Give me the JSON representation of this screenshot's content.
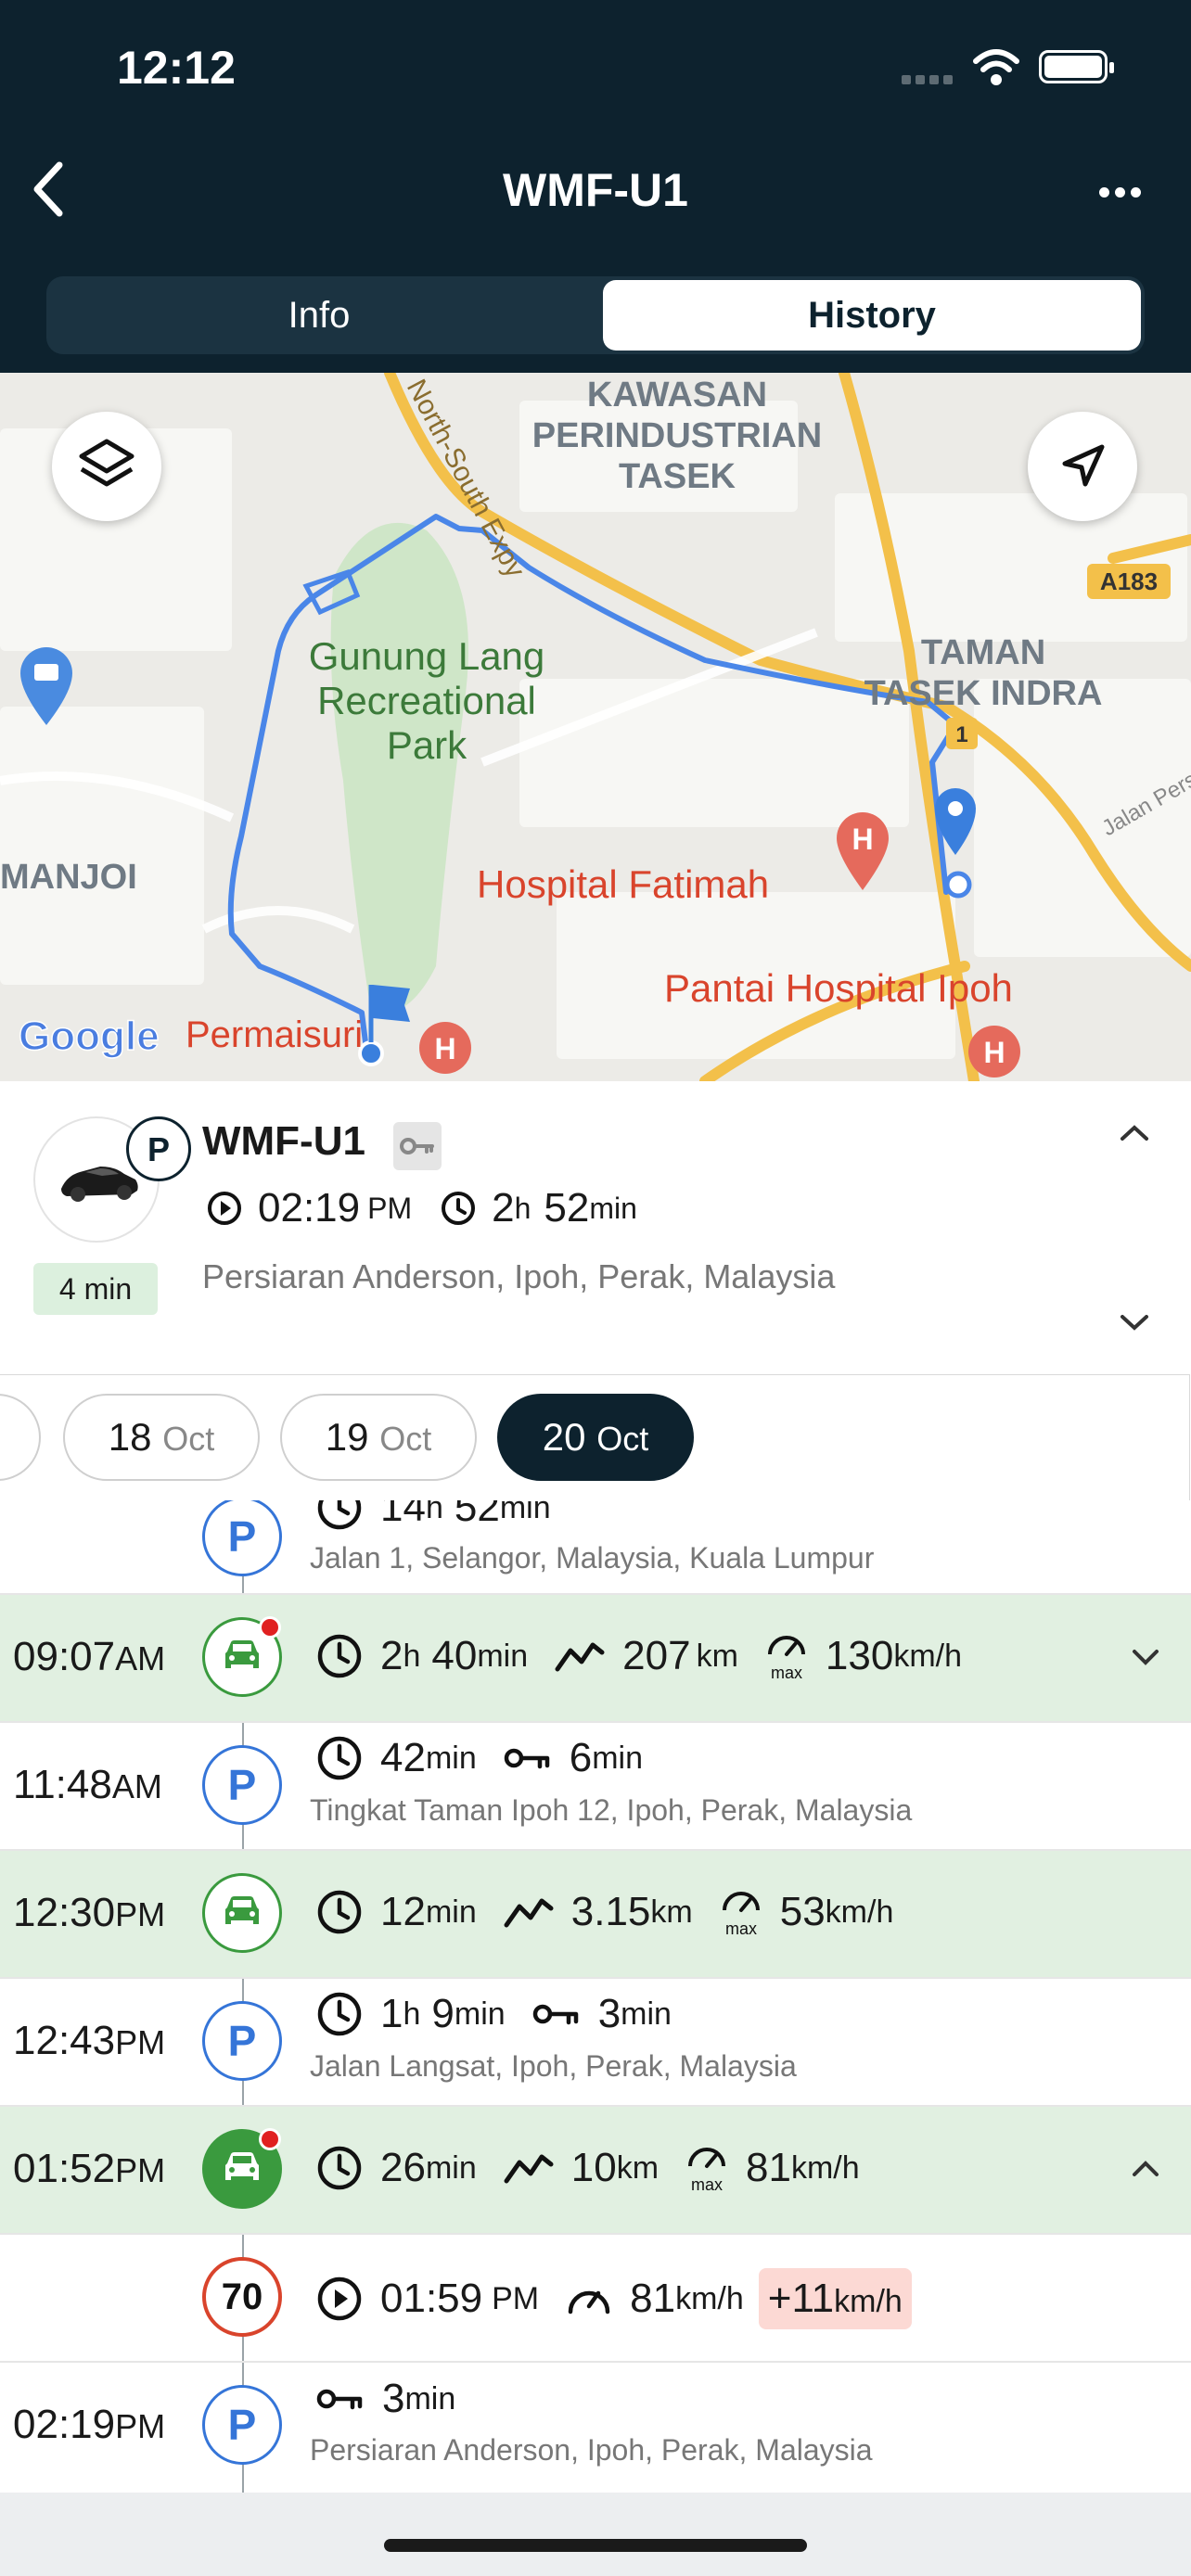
{
  "status": {
    "time": "12:12"
  },
  "header": {
    "title": "WMF-U1"
  },
  "tabs": [
    {
      "label": "Info"
    },
    {
      "label": "History"
    }
  ],
  "map": {
    "labels": {
      "area1": "KAWASAN\nPERINDUSTRIAN\nTASEK",
      "park": "Gunung Lang\nRecreational\nPark",
      "area2": "TAMAN\nTASEK INDRA",
      "west": "MANJOI",
      "hosp1": "Hospital Fatimah",
      "hosp2": "Pantai Hospital Ipoh",
      "perma": "Permaisuri",
      "raja": "Raja Permaisuri Bainun Hospital Ipoh",
      "road": "North-South Expy",
      "route": "A183",
      "jalan": "Jalan Pers",
      "google": "Google"
    }
  },
  "vehicle": {
    "name": "WMF-U1",
    "time": "02:19",
    "time_suffix": "PM",
    "dur_h": "2",
    "dur_h_unit": "h",
    "dur_m": "52",
    "dur_m_unit": "min",
    "address": "Persiaran Anderson, Ipoh, Perak, Malaysia",
    "ago": "4 min",
    "status_badge": "P"
  },
  "dates": [
    {
      "day": "18",
      "month": "Oct"
    },
    {
      "day": "19",
      "month": "Oct"
    },
    {
      "day": "20",
      "month": "Oct"
    }
  ],
  "timeline": {
    "r0": {
      "dur_a": "14",
      "dur_a_unit": "h",
      "dur_b": "52",
      "dur_b_unit": "min",
      "address": "Jalan 1, Selangor, Malaysia, Kuala Lumpur"
    },
    "r1": {
      "time": "09:07",
      "ap": "AM",
      "dur_a": "2",
      "dur_a_unit": "h",
      "dur_b": "40",
      "dur_b_unit": "min",
      "dist": "207",
      "dist_unit": "km",
      "max": "130",
      "max_unit": "km/h"
    },
    "r2": {
      "time": "11:48",
      "ap": "AM",
      "dur": "42",
      "dur_unit": "min",
      "idle": "6",
      "idle_unit": "min",
      "address": "Tingkat Taman Ipoh 12, Ipoh, Perak, Malaysia"
    },
    "r3": {
      "time": "12:30",
      "ap": "PM",
      "dur": "12",
      "dur_unit": "min",
      "dist": "3.15",
      "dist_unit": "km",
      "max": "53",
      "max_unit": "km/h"
    },
    "r4": {
      "time": "12:43",
      "ap": "PM",
      "dur_a": "1",
      "dur_a_unit": "h",
      "dur_b": "9",
      "dur_b_unit": "min",
      "idle": "3",
      "idle_unit": "min",
      "address": "Jalan Langsat, Ipoh, Perak, Malaysia"
    },
    "r5": {
      "time": "01:52",
      "ap": "PM",
      "dur": "26",
      "dur_unit": "min",
      "dist": "10",
      "dist_unit": "km",
      "max": "81",
      "max_unit": "km/h"
    },
    "r6": {
      "limit": "70",
      "time": "01:59",
      "ap": "PM",
      "speed": "81",
      "speed_unit": "km/h",
      "over": "+11",
      "over_unit": "km/h"
    },
    "r7": {
      "time": "02:19",
      "ap": "PM",
      "idle": "3",
      "idle_unit": "min",
      "address": "Persiaran Anderson, Ipoh, Perak, Malaysia"
    }
  },
  "icons": {
    "max_label": "max",
    "park_letter": "P"
  },
  "colors": {
    "header": "#0d222e",
    "drive_bg": "#e1f0e1",
    "park_blue": "#3575d8",
    "drive_green": "#3a9a3e",
    "speed_red": "#d9442c",
    "route": "#4a86e8"
  }
}
